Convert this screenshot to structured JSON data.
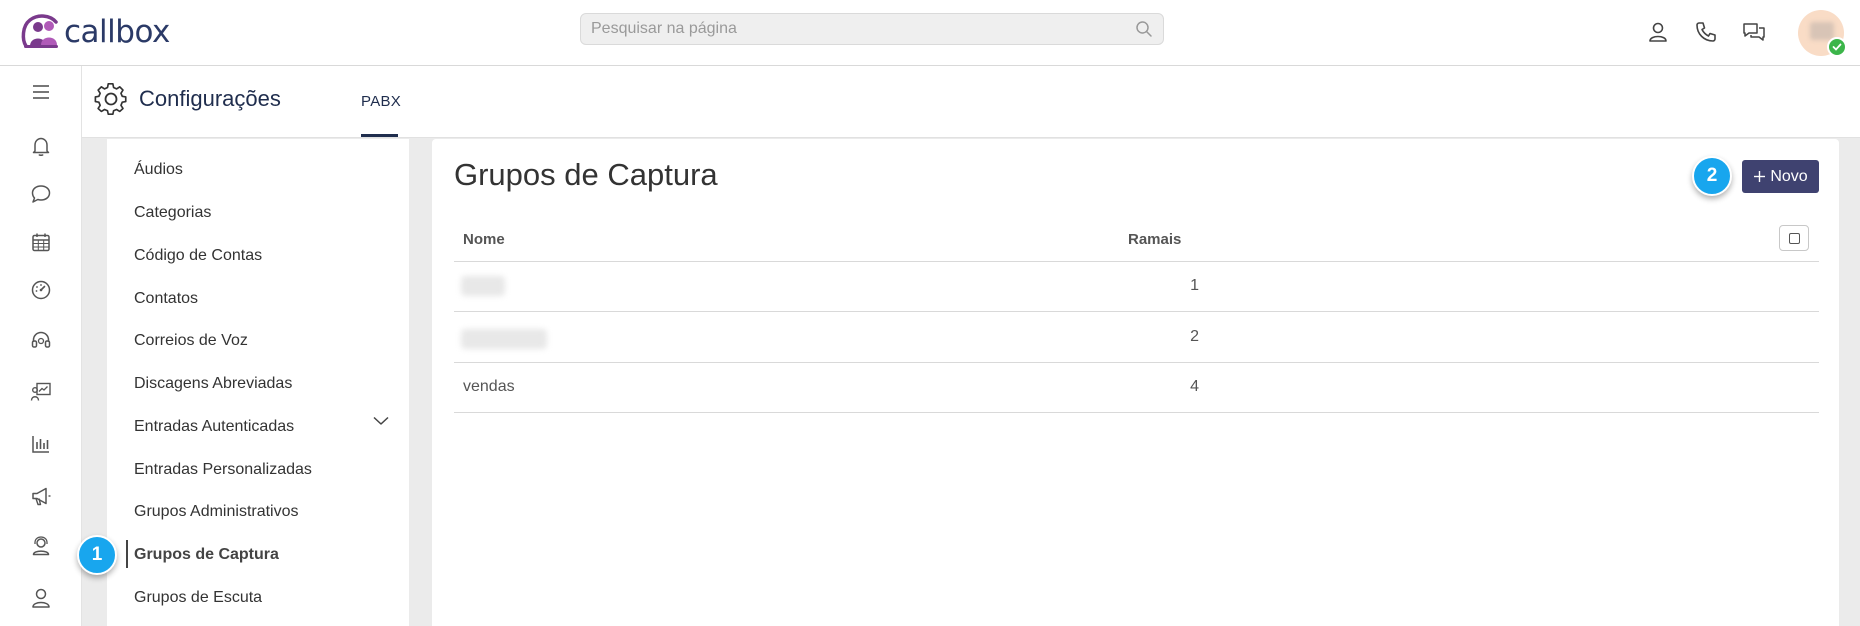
{
  "app": {
    "brand": "callbox"
  },
  "search": {
    "placeholder": "Pesquisar na página",
    "value": ""
  },
  "header_icons": [
    "user-icon",
    "phone-icon",
    "chat-bubbles-icon"
  ],
  "rail_icons": [
    "hamburger-menu-icon",
    "bell-icon",
    "chat-icon",
    "calendar-icon",
    "dashboard-gauge-icon",
    "headset-icon",
    "presentation-icon",
    "bar-chart-icon",
    "megaphone-icon",
    "support-agent-icon",
    "user-icon"
  ],
  "settings": {
    "title": "Configurações",
    "tab_pabx": "PABX"
  },
  "submenu": {
    "items": [
      {
        "label": "Áudios"
      },
      {
        "label": "Categorias"
      },
      {
        "label": "Código de Contas"
      },
      {
        "label": "Contatos"
      },
      {
        "label": "Correios de Voz"
      },
      {
        "label": "Discagens Abreviadas"
      },
      {
        "label": "Entradas Autenticadas"
      },
      {
        "label": "Entradas Personalizadas"
      },
      {
        "label": "Grupos Administrativos"
      },
      {
        "label": "Grupos de Captura"
      },
      {
        "label": "Grupos de Escuta"
      }
    ],
    "active_index": 9
  },
  "main": {
    "title": "Grupos de Captura",
    "new_button": "Novo",
    "columns": {
      "name": "Nome",
      "ramais": "Ramais"
    },
    "rows": [
      {
        "nome": "",
        "ramais": "1"
      },
      {
        "nome": "",
        "ramais": "2"
      },
      {
        "nome": "vendas",
        "ramais": "4"
      }
    ]
  },
  "badges": {
    "step1": "1",
    "step2": "2"
  },
  "colors": {
    "accent": "#3f4270",
    "badge": "#18a6ee",
    "status_online": "#3cb54a",
    "brand_purple": "#7a3a8c"
  }
}
